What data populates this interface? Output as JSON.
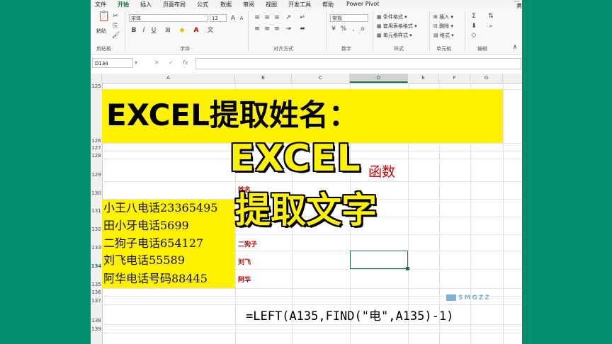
{
  "menu": {
    "tabs": [
      "文件",
      "开始",
      "插入",
      "页面布局",
      "公式",
      "数据",
      "审阅",
      "视图",
      "开发工具",
      "帮助",
      "Power Pivot"
    ],
    "share": "共享"
  },
  "ribbon": {
    "paste": "粘贴",
    "font_name": "宋体",
    "font_size": "12",
    "number_format": "常规",
    "conditional_format": "条件格式",
    "table_format": "套用表格格式",
    "cell_style": "单元格样式",
    "insert": "插入",
    "delete": "删除",
    "format": "格式",
    "groups": [
      "剪贴板",
      "字体",
      "对齐方式",
      "数字",
      "样式",
      "单元格",
      "编辑"
    ],
    "percent": "%",
    "comma": ",",
    "bold": "B",
    "italic": "I",
    "underline": "U"
  },
  "formula_bar": {
    "name_box": "D134",
    "fx": "fx",
    "cancel": "✕",
    "enter": "✓"
  },
  "columns": [
    "A",
    "B",
    "C",
    "D",
    "E",
    "F",
    "G"
  ],
  "rows": [
    "125",
    "126",
    "127",
    "128",
    "129",
    "130",
    "131",
    "132",
    "133",
    "134",
    "135",
    "136",
    "137",
    "138",
    "139"
  ],
  "sheet": {
    "title": "EXCEL提取姓名：",
    "a_cells": [
      "小王八电话23365495",
      "田小牙电话5699",
      "二狗子电话654127",
      "刘飞电话55589",
      "阿华电话号码88445"
    ],
    "b_header": "姓名",
    "b_values": [
      "二狗子",
      "刘飞",
      "阿华"
    ],
    "c_partial": "函数",
    "formula": "=LEFT(A135,FIND(\"电\",A135)-1)"
  },
  "overlay": {
    "line1": "EXCEL",
    "line2": "提取文字"
  },
  "watermark": "SMGZZ",
  "colors": {
    "bg_green": "#008f6f",
    "highlight_yellow": "#fff200",
    "excel_green": "#217346",
    "red": "#c00000"
  }
}
